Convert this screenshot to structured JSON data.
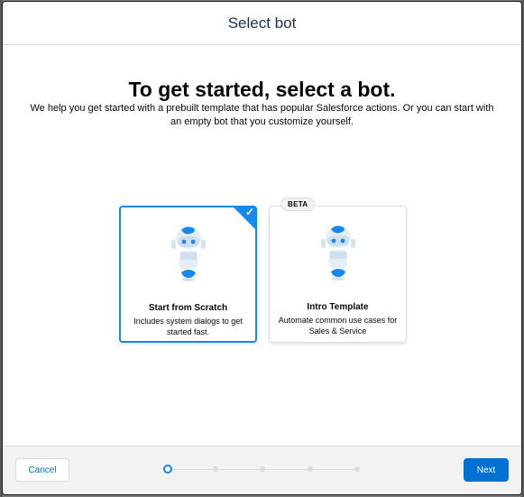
{
  "modal": {
    "title": "Select bot"
  },
  "main": {
    "headline": "To get started, select a bot.",
    "subtext": "We help you get started with a prebuilt template that has popular Salesforce actions. Or you can start with an empty bot that you customize yourself."
  },
  "cards": [
    {
      "title": "Start from Scratch",
      "desc": "Includes system dialogs to get started fast.",
      "selected": true,
      "icon": "bot-icon"
    },
    {
      "title": "Intro Template",
      "desc": "Automate common use cases for Sales & Service",
      "badge": "BETA",
      "selected": false,
      "icon": "bot-icon"
    }
  ],
  "footer": {
    "cancel_label": "Cancel",
    "next_label": "Next",
    "steps": {
      "current": 1,
      "total": 5
    }
  },
  "colors": {
    "accent": "#1589ee",
    "brand_button": "#0070d2",
    "title_text": "#16325c"
  }
}
